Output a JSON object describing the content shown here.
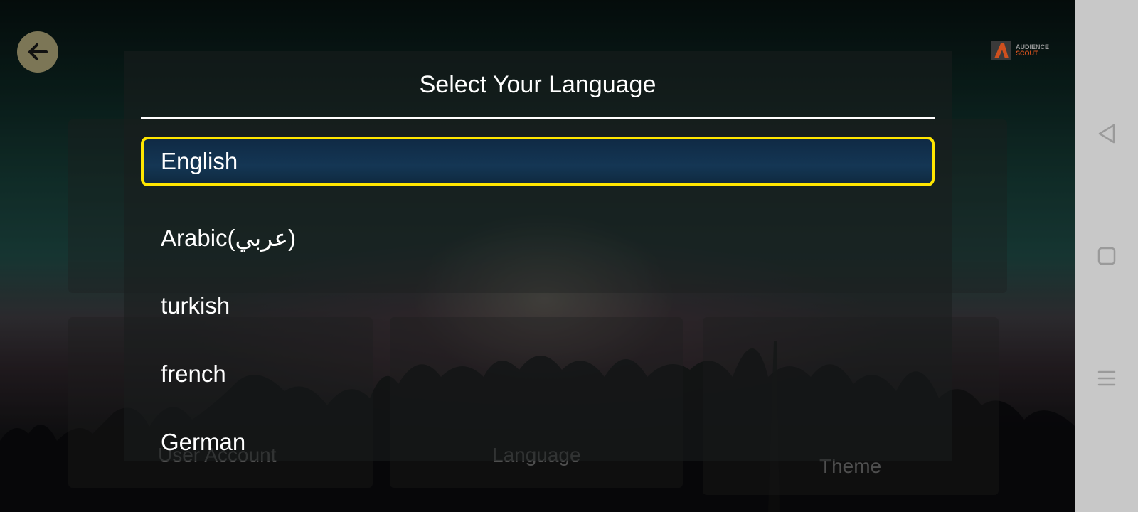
{
  "dialog": {
    "title": "Select Your Language",
    "languages": [
      {
        "label": "English",
        "selected": true
      },
      {
        "label": "Arabic(عربي)",
        "selected": false
      },
      {
        "label": "turkish",
        "selected": false
      },
      {
        "label": "french",
        "selected": false
      },
      {
        "label": "German",
        "selected": false
      }
    ]
  },
  "background": {
    "cards": [
      {
        "label": "User Account"
      },
      {
        "label": "Language"
      },
      {
        "label": "Theme"
      }
    ]
  },
  "header": {
    "logo_line1": "AUDIENCE",
    "logo_line2": "SCOUT"
  },
  "colors": {
    "highlight": "#ffe600",
    "back_button": "#7c7656",
    "logo_accent": "#d0501e"
  },
  "icons": {
    "back": "arrow-left-icon",
    "nav_back": "triangle-back-icon",
    "nav_home": "square-home-icon",
    "nav_menu": "menu-lines-icon"
  }
}
